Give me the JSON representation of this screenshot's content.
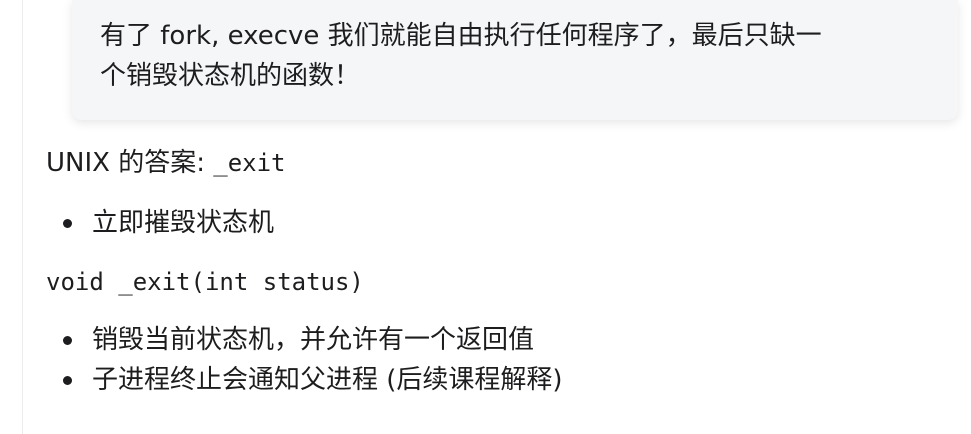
{
  "callout": {
    "text_line1": "有了 fork, execve 我们就能自由执行任何程序了，最后只缺一",
    "text_line2": "个销毁状态机的函数！"
  },
  "answer": {
    "prefix": "UNIX 的答案: ",
    "code": "_exit"
  },
  "bullets_first": [
    "立即摧毁状态机"
  ],
  "code_signature": "void _exit(int status)",
  "bullets_second": [
    "销毁当前状态机，并允许有一个返回值",
    "子进程终止会通知父进程 (后续课程解释)"
  ]
}
